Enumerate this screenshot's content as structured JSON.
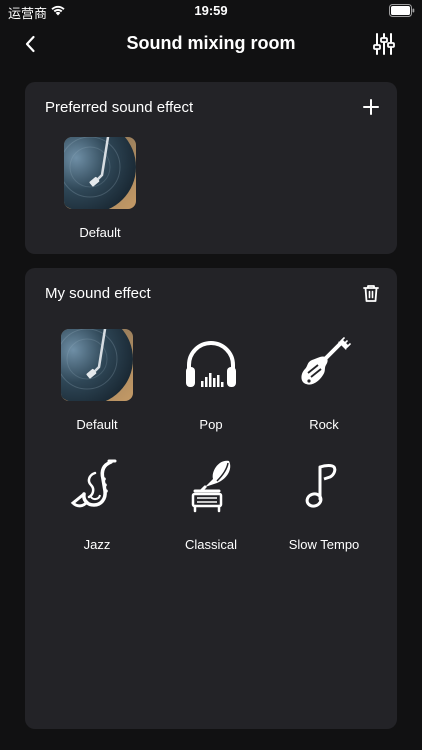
{
  "status_bar": {
    "carrier": "运营商",
    "time": "19:59"
  },
  "nav": {
    "title": "Sound mixing room",
    "back_icon": "chevron-left-icon",
    "settings_icon": "equalizer-sliders-icon"
  },
  "preferred_section": {
    "title": "Preferred sound effect",
    "action_icon": "plus-icon",
    "items": [
      {
        "label": "Default",
        "icon": "turntable-record-thumbnail"
      }
    ]
  },
  "my_section": {
    "title": "My sound effect",
    "action_icon": "trash-icon",
    "items": [
      {
        "label": "Default",
        "icon": "turntable-record-thumbnail"
      },
      {
        "label": "Pop",
        "icon": "headphones-icon"
      },
      {
        "label": "Rock",
        "icon": "electric-guitar-icon"
      },
      {
        "label": "Jazz",
        "icon": "saxophone-icon"
      },
      {
        "label": "Classical",
        "icon": "gramophone-icon"
      },
      {
        "label": "Slow Tempo",
        "icon": "music-note-icon"
      }
    ]
  },
  "colors": {
    "background": "#111112",
    "card": "#232327",
    "text": "#ffffff"
  }
}
